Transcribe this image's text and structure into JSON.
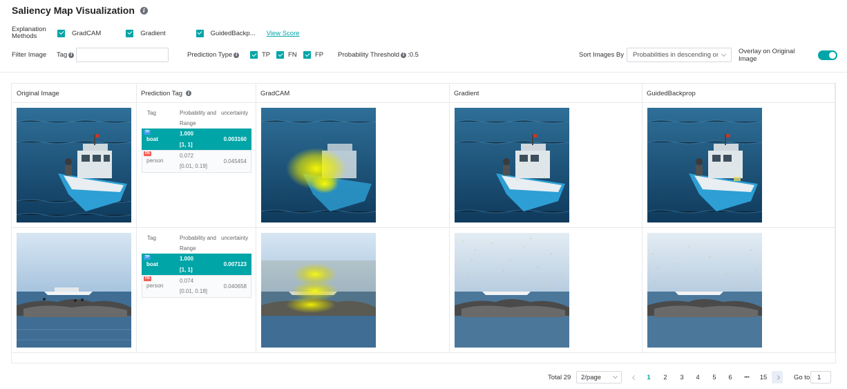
{
  "title": "Saliency Map Visualization",
  "explanation": {
    "label": "Explanation Methods",
    "methods": [
      {
        "label": "GradCAM",
        "checked": true
      },
      {
        "label": "Gradient",
        "checked": true
      },
      {
        "label": "GuidedBackp...",
        "checked": true
      }
    ],
    "view_score": "View Score"
  },
  "filter": {
    "label": "Filter Image",
    "tag_label": "Tag",
    "tag_value": "",
    "prediction_type_label": "Prediction Type",
    "prediction_types": [
      {
        "label": "TP",
        "checked": true
      },
      {
        "label": "FN",
        "checked": true
      },
      {
        "label": "FP",
        "checked": true
      }
    ],
    "prob_threshold_label": "Probability Threshold",
    "prob_threshold_value": ":0.5",
    "sort_label": "Sort Images By",
    "sort_value": "Probabilities in descending or",
    "overlay_label": "Overlay on Original Image",
    "overlay_on": true
  },
  "table": {
    "columns": [
      "Original Image",
      "Prediction Tag",
      "GradCAM",
      "Gradient",
      "GuidedBackprop"
    ],
    "pred_headers": {
      "tag": "Tag",
      "prob": "Probability and Range",
      "prob_line1": "Probability and",
      "prob_line2": "Range",
      "uncertainty": "uncertainty"
    },
    "rows": [
      {
        "image": "boat-on-water",
        "predictions": [
          {
            "badge": "TP",
            "tag": "boat",
            "probability": "1.000",
            "range": "[1, 1]",
            "uncertainty": "0.003160",
            "highlight": true
          },
          {
            "badge": "FN",
            "tag": "person",
            "probability": "0.072",
            "range": "[0.01, 0.19]",
            "uncertainty": "0.045454",
            "highlight": false
          }
        ]
      },
      {
        "image": "yacht-and-rocks",
        "predictions": [
          {
            "badge": "TP",
            "tag": "boat",
            "probability": "1.000",
            "range": "[1, 1]",
            "uncertainty": "0.007123",
            "highlight": true
          },
          {
            "badge": "FN",
            "tag": "person",
            "probability": "0.074",
            "range": "[0.01, 0.18]",
            "uncertainty": "0.040658",
            "highlight": false
          }
        ]
      }
    ]
  },
  "pagination": {
    "total": "Total 29",
    "page_size": "2/page",
    "pages": [
      "1",
      "2",
      "3",
      "4",
      "5",
      "6",
      "•••",
      "15"
    ],
    "current": "1",
    "goto_label": "Go to",
    "goto_value": "1"
  },
  "colors": {
    "accent": "#00a5a7",
    "tp_badge": "#3aa0e6",
    "fn_badge": "#f06059"
  },
  "icons": {
    "info": "info-icon",
    "checkbox": "checkbox-checked-icon",
    "chevron": "chevron-down-icon"
  }
}
